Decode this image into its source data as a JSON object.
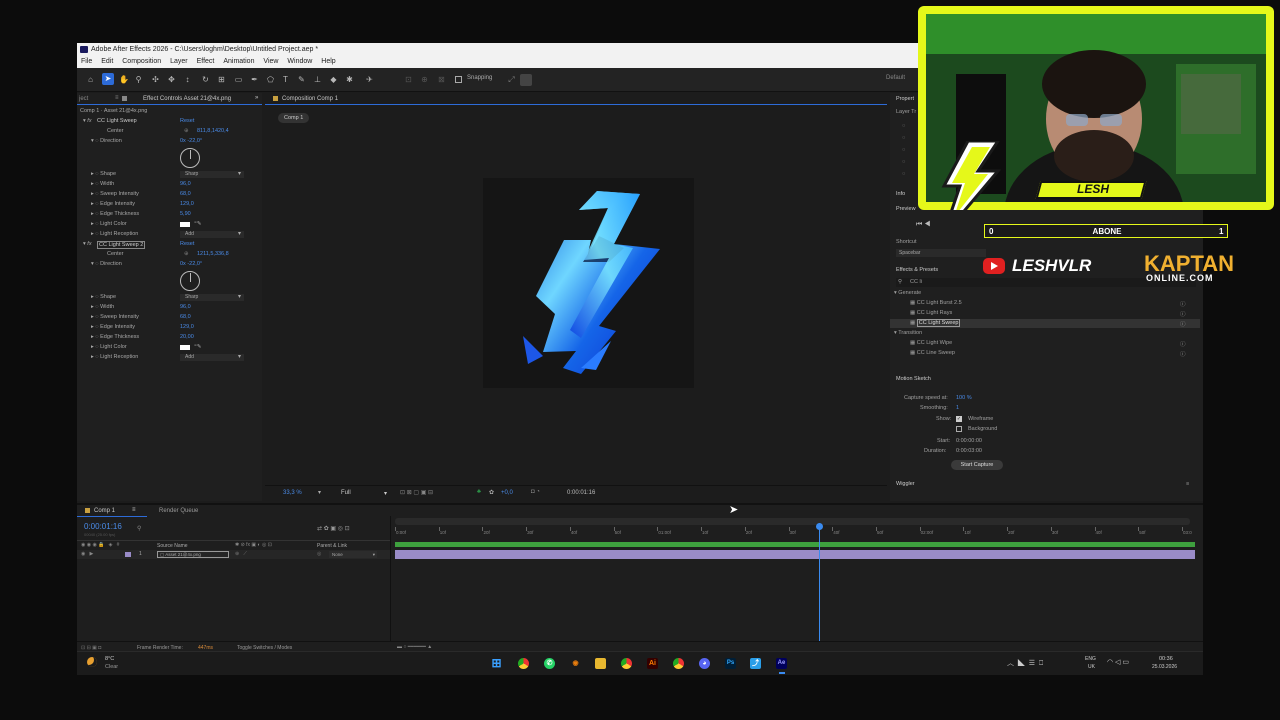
{
  "window": {
    "title": "Adobe After Effects 2026 - C:\\Users\\loghm\\Desktop\\Untitled Project.aep *"
  },
  "menu": [
    "File",
    "Edit",
    "Composition",
    "Layer",
    "Effect",
    "Animation",
    "View",
    "Window",
    "Help"
  ],
  "toolbar": {
    "snapping_label": "Snapping",
    "workspace_label": "Default"
  },
  "project_panel": {
    "tab": "ject"
  },
  "effect_controls": {
    "tab": "Effect Controls Asset 21@4x.png",
    "header": "Comp 1 · Asset 21@4x.png",
    "effects": [
      {
        "name": "CC Light Sweep",
        "reset": "Reset",
        "center_label": "Center",
        "center": "811,8,1420,4",
        "direction_label": "Direction",
        "direction": "0x -22,0°",
        "props": [
          {
            "label": "Shape",
            "value": "Sharp",
            "type": "select"
          },
          {
            "label": "Width",
            "value": "96,0"
          },
          {
            "label": "Sweep Intensity",
            "value": "68,0"
          },
          {
            "label": "Edge Intensity",
            "value": "129,0"
          },
          {
            "label": "Edge Thickness",
            "value": "5,90"
          },
          {
            "label": "Light Color",
            "value": "",
            "type": "color"
          },
          {
            "label": "Light Reception",
            "value": "Add",
            "type": "select"
          }
        ]
      },
      {
        "name": "CC Light Sweep 2",
        "reset": "Reset",
        "center_label": "Center",
        "center": "1211,5,336,8",
        "direction_label": "Direction",
        "direction": "0x -22,0°",
        "props": [
          {
            "label": "Shape",
            "value": "Sharp",
            "type": "select"
          },
          {
            "label": "Width",
            "value": "96,0"
          },
          {
            "label": "Sweep Intensity",
            "value": "68,0"
          },
          {
            "label": "Edge Intensity",
            "value": "129,0"
          },
          {
            "label": "Edge Thickness",
            "value": "20,00"
          },
          {
            "label": "Light Color",
            "value": "",
            "type": "color"
          },
          {
            "label": "Light Reception",
            "value": "Add",
            "type": "select"
          }
        ]
      }
    ]
  },
  "composition": {
    "tab": "Composition Comp 1",
    "breadcrumb": "Comp 1",
    "zoom": "33,3 %",
    "resolution": "Full",
    "time": "0:00:01:16"
  },
  "properties_panel": {
    "title": "Propert",
    "layer_label": "Layer Tr",
    "info_label": "Info",
    "preview_label": "Preview",
    "shortcut_label": "Shortcut",
    "shortcut_value": "Spacebar"
  },
  "effects_presets": {
    "title": "Effects & Presets",
    "search": "CC li",
    "groups": [
      {
        "name": "Generate",
        "items": [
          "CC Light Burst 2.5",
          "CC Light Rays",
          "CC Light Sweep"
        ]
      },
      {
        "name": "Transition",
        "items": [
          "CC Light Wipe",
          "CC Line Sweep"
        ]
      }
    ]
  },
  "motion_sketch": {
    "title": "Motion Sketch",
    "capture_label": "Capture speed at:",
    "capture_value": "100 %",
    "smoothing_label": "Smoothing:",
    "smoothing_value": "1",
    "show_label": "Show:",
    "wireframe": "Wireframe",
    "background": "Background",
    "start_label": "Start:",
    "start_value": "0:00:00:00",
    "duration_label": "Duration:",
    "duration_value": "0:00:03:00",
    "button": "Start Capture",
    "wiggler": "Wiggler"
  },
  "timeline": {
    "tab": "Comp 1",
    "queue_tab": "Render Queue",
    "timecode": "0:00:01:16",
    "fps": "00040 (25.00 fps)",
    "col_source": "Source Name",
    "col_parent": "Parent & Link",
    "layer_num": "1",
    "layer_name": "Asset 21@4x.png",
    "parent_value": "None",
    "ruler": [
      "0:00f",
      "10f",
      "20f",
      "30f",
      "40f",
      "50f",
      "01:00f",
      "10f",
      "20f",
      "30f",
      "40f",
      "50f",
      "02:00f",
      "10f",
      "20f",
      "30f",
      "40f",
      "50f",
      "03:0"
    ],
    "frame_render_label": "Frame Render Time:",
    "frame_render_value": "447ms",
    "toggle_label": "Toggle Switches / Modes",
    "playhead": 0.53
  },
  "taskbar": {
    "temp": "8°C",
    "weather": "Clear",
    "lang": "ENG",
    "region": "UK",
    "time": "00:36",
    "date": "25.03.2026"
  },
  "overlay": {
    "streamer_name": "LESH",
    "sub_left": "0",
    "sub_center": "ABONE",
    "sub_right": "1",
    "channel": "LESHVLR",
    "sponsor_line1": "KAPTAN",
    "sponsor_line2": "ONLINE.COM"
  },
  "colors": {
    "accent": "#2d6bd8",
    "value_blue": "#4a8be8",
    "timeline_green": "#3ea03e",
    "layer_purple": "#9a8cc8",
    "overlay_yellow": "#e5f81a"
  }
}
